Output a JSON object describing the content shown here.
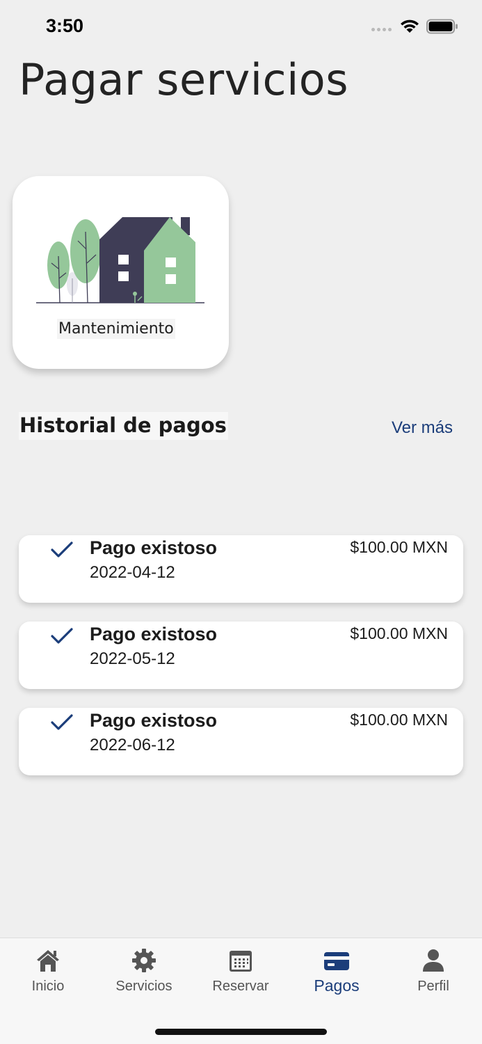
{
  "status_bar": {
    "time": "3:50"
  },
  "page": {
    "title": "Pagar servicios"
  },
  "services": [
    {
      "label": "Mantenimiento",
      "icon": "house-illustration"
    }
  ],
  "history": {
    "title": "Historial de pagos",
    "see_more": "Ver más",
    "payments": [
      {
        "status": "Pago existoso",
        "date": "2022-04-12",
        "amount": "$100.00 MXN"
      },
      {
        "status": "Pago existoso",
        "date": "2022-05-12",
        "amount": "$100.00 MXN"
      },
      {
        "status": "Pago existoso",
        "date": "2022-06-12",
        "amount": "$100.00 MXN"
      }
    ]
  },
  "tab_bar": {
    "active": "Pagos",
    "tabs": [
      {
        "label": "Inicio",
        "icon": "home-icon"
      },
      {
        "label": "Servicios",
        "icon": "gear-icon"
      },
      {
        "label": "Reservar",
        "icon": "calendar-icon"
      },
      {
        "label": "Pagos",
        "icon": "credit-card-icon"
      },
      {
        "label": "Perfil",
        "icon": "person-icon"
      }
    ]
  },
  "colors": {
    "accent": "#1b3d7a",
    "background": "#efefef",
    "house_dark": "#3f3d56",
    "house_green": "#95c79a"
  }
}
